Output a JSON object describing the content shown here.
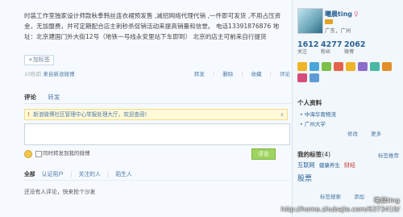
{
  "post": {
    "text": "时装工作室独家设计师款秋季韩丝连衣裙预发售 ,减招网络代理代销 ,一件即可发货 ,不用占压资金，无加盟费，并可定期配合店主刺秒杀促销活动来提高销量和信誉。 电话13391876876 地址：北京建国门外大街12号（地铁一号线永安里站下车即到） 北京的店主可前来自行提货",
    "add_tag": "+加标签",
    "source_prefix": "10秒前",
    "source_link": "来自新浪微博",
    "actions": [
      "转发",
      "删除",
      "收藏",
      "评论"
    ],
    "sep": "|"
  },
  "comment_tabs": [
    "评论",
    "转发"
  ],
  "notice": {
    "icon": "!",
    "text": "新浪微博社区管理中心举报处理大厅，欢迎查阅!",
    "close": "x"
  },
  "comment_bar": {
    "checkbox_label": "同时转发到我的微博",
    "submit": "评论"
  },
  "filter": {
    "all": "全部",
    "options": [
      "认证用户",
      "关注的人",
      "陌生人"
    ],
    "sep": "|"
  },
  "no_comments": "还没有人评论，快来抢个沙发",
  "profile": {
    "name": "曦晨ting",
    "gender_symbol": "♀",
    "location": "广东，广州",
    "stats": [
      {
        "value": "1612",
        "label": "关注"
      },
      {
        "value": "4277",
        "label": "粉丝"
      },
      {
        "value": "2062",
        "label": "微博"
      }
    ]
  },
  "personal_info": {
    "title": "个人资料",
    "lines": [
      "中海华南物流",
      "广州大学"
    ],
    "edit": "修改",
    "more": "更多"
  },
  "my_tags": {
    "title": "我的标签",
    "count": "(4)",
    "recommend": "标签推荐",
    "tags_row1": [
      "互联网",
      "健康养生",
      "财经"
    ],
    "tags_row2": [
      "股票"
    ],
    "search": "标签搜索",
    "add": "添加"
  },
  "watermark": {
    "name": "曦晨ting",
    "url": "http://home.zhubajie.com/6373419/"
  },
  "colors": {
    "link": "#4c78a8",
    "submit_green": "#9ed45f",
    "notice_bg": "#fff9d8"
  }
}
